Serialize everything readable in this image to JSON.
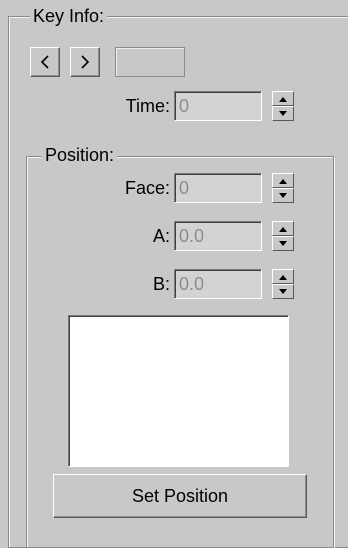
{
  "key_info": {
    "legend": "Key Info:",
    "prev_label": "<",
    "next_label": ">",
    "key_number": ""
  },
  "time": {
    "label": "Time:",
    "value": "0"
  },
  "position": {
    "legend": "Position:",
    "face": {
      "label": "Face:",
      "value": "0"
    },
    "a": {
      "label": "A:",
      "value": "0.0"
    },
    "b": {
      "label": "B:",
      "value": "0.0"
    },
    "list_items": [],
    "set_button": "Set Position"
  },
  "icons": {
    "prev": "chevron-left-icon",
    "next": "chevron-right-icon",
    "spin_up": "triangle-up-icon",
    "spin_down": "triangle-down-icon"
  }
}
